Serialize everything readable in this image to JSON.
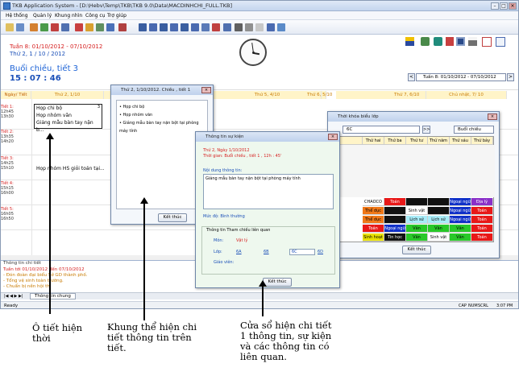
{
  "app": {
    "title": "TKB Application System - [D:\\Hebv\\Temp\\TKB\\TKB 9.0\\Data\\MACDINHCHI_FULL.TKB]"
  },
  "menu": [
    "Hệ thống",
    "Quản lý",
    "Khung nhìn",
    "Công cụ",
    "Trợ giúp"
  ],
  "header": {
    "week": "Tuần 8: 01/10/2012 - 07/10/2012",
    "today": "Thứ 2, 1 / 10 / 2012",
    "session": "Buổi chiều, tiết 3",
    "clock": "15 : 07 : 46",
    "week_select": "Tuần 8: 01/10/2012 - 07/10/2012"
  },
  "grid": {
    "corner": "Ngày/ Tiết",
    "days": [
      "Thứ 2, 1/10",
      "Thứ 5, 4/10",
      "Thứ 6, 5/10",
      "Thứ 7, 6/10",
      "Chủ nhật, 7/ 10"
    ],
    "periods": [
      {
        "name": "Tiết 1:",
        "start": "12h45",
        "end": "13h30"
      },
      {
        "name": "Tiết 2:",
        "start": "13h35",
        "end": "14h20"
      },
      {
        "name": "Tiết 3:",
        "start": "14h25",
        "end": "15h10"
      },
      {
        "name": "Tiết 4:",
        "start": "15h15",
        "end": "16h00"
      },
      {
        "name": "Tiết 5:",
        "start": "16h05",
        "end": "16h50"
      }
    ],
    "cell_items": [
      "Họp chi bộ",
      "Họp nhóm văn",
      "Giảng mẫu bàn tay nặn b..."
    ],
    "cell_count": "3",
    "period3_item": "Họp nhóm HS giỏi toán tại..."
  },
  "detail_window": {
    "title": "Thứ 2, 1/10/2012. Chiều , tiết 1",
    "items": [
      "Họp chi bộ",
      "Họp nhóm văn",
      "Giảng mẫu bàn tay nặn bột tại phòng máy tính"
    ],
    "close_label": "Kết thúc"
  },
  "timetable_window": {
    "title": "Thời khóa biểu lớp",
    "class_select": "6C",
    "session_select": "Buổi chiều",
    "columns": [
      "Thứ hai",
      "Thứ ba",
      "Thứ tư",
      "Thứ năm",
      "Thứ sáu",
      "Thứ bảy"
    ],
    "rows": [
      [
        "CHAOCO",
        "Toán",
        "",
        "",
        "Ngoại ngữ",
        "Địa lý"
      ],
      [
        "Thể dục",
        "",
        "Sinh vật",
        "",
        "Ngoại ngữ",
        "Toán"
      ],
      [
        "Thể dục",
        "",
        "Lịch sử",
        "Lịch sử",
        "Ngoại ngữ",
        "Toán"
      ],
      [
        "Toán",
        "Ngoại ngữ",
        "Văn",
        "Văn",
        "Văn",
        "Toán"
      ],
      [
        "Sinh hoạt",
        "Tin học",
        "Văn",
        "Sinh vật",
        "Văn",
        "Toán"
      ]
    ],
    "close_label": "Kết thúc"
  },
  "info_window": {
    "title": "Thông tin sự kiện",
    "date": "Thứ 2, Ngày 1/10/2012",
    "time": "Thời gian: Buổi chiều , tiết 1 , 12h : 45'",
    "content_label": "Nội dung thông tin:",
    "content": "Giảng mẫu bàn tay nặn bột tại phòng máy tính",
    "level": "Mức độ: Bình thường",
    "related_label": "Thông tin Tham chiếu liên quan",
    "subject_label": "Môn:",
    "subject": "Vật lý",
    "class_label": "Lớp:",
    "classes": [
      "6A",
      "6B",
      "6C",
      "6D"
    ],
    "teacher_label": "Giáo viên:",
    "close_label": "Kết thúc"
  },
  "detail_pane": {
    "title": "Thông tin chi tiết",
    "week_line": "Tuần tới 01/10/2012 đến 07/10/2012",
    "lines": [
      "- Đón đoàn đại biểu Sở GD thành phố.",
      "- Tổng vệ sinh toàn trường.",
      "- Chuẩn bị nền hội thi"
    ]
  },
  "tab": "Thông tin chung",
  "status": {
    "left": "Ready",
    "indicators": [
      "CAP",
      "NUM",
      "SCRL"
    ],
    "time": "3:07 PM"
  },
  "captions": {
    "cell": "Ô tiết hiện thời",
    "frame": "Khung thể hiện chi tiết thông tin trên tiết.",
    "window": "Cửa sổ hiện chi tiết 1 thông tin, sự kiện và các thông tin có liên quan."
  },
  "colors": {
    "accent": "#1d63d6",
    "red": "#d62020"
  }
}
